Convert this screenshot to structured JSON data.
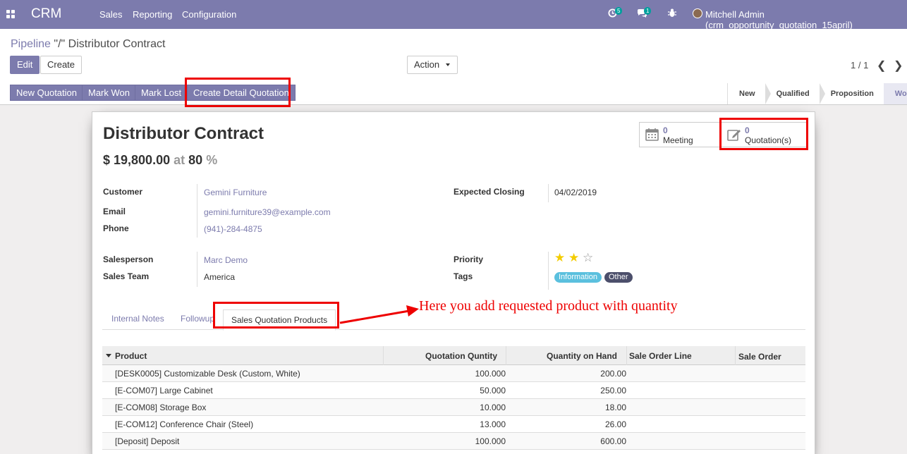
{
  "topbar": {
    "brand": "CRM",
    "menu": [
      "Sales",
      "Reporting",
      "Configuration"
    ],
    "activity_count": "5",
    "message_count": "1",
    "user": "Mitchell Admin (crm_opportunity_quotation_15april)"
  },
  "breadcrumb": {
    "parent": "Pipeline",
    "separator": " \"/\" ",
    "current": "Distributor Contract"
  },
  "buttons": {
    "edit": "Edit",
    "create": "Create",
    "action": "Action",
    "new_quotation": "New Quotation",
    "mark_won": "Mark Won",
    "mark_lost": "Mark Lost",
    "create_detail_quotation": "Create Detail Quotation"
  },
  "pager": "1 / 1",
  "stages": [
    "New",
    "Qualified",
    "Proposition",
    "Won"
  ],
  "active_stage": "Won",
  "record": {
    "title": "Distributor Contract",
    "revenue": "$ 19,800.00",
    "at": "at",
    "probability": "80",
    "percent": "%"
  },
  "stat_buttons": {
    "meeting_count": "0",
    "meeting_label": "Meeting",
    "quotation_count": "0",
    "quotation_label": "Quotation(s)"
  },
  "fields": {
    "customer_label": "Customer",
    "customer": "Gemini Furniture",
    "email_label": "Email",
    "email": "gemini.furniture39@example.com",
    "phone_label": "Phone",
    "phone": "(941)-284-4875",
    "closing_label": "Expected Closing",
    "closing": "04/02/2019",
    "salesperson_label": "Salesperson",
    "salesperson": "Marc Demo",
    "team_label": "Sales Team",
    "team": "America",
    "priority_label": "Priority",
    "priority_stars": 2,
    "priority_max": 3,
    "tags_label": "Tags",
    "tags": [
      "Information",
      "Other"
    ]
  },
  "tabs": [
    "Internal Notes",
    "Followup",
    "Sales Quotation Products"
  ],
  "annotation": "Here you add requested product with quantity",
  "table": {
    "headers": [
      "Product",
      "Quotation Quntity",
      "Quantity on Hand",
      "Sale Order Line",
      "Sale Order"
    ],
    "rows": [
      [
        "[DESK0005] Customizable Desk (Custom, White)",
        "100.000",
        "200.00"
      ],
      [
        "[E-COM07] Large Cabinet",
        "50.000",
        "250.00"
      ],
      [
        "[E-COM08] Storage Box",
        "10.000",
        "18.00"
      ],
      [
        "[E-COM12] Conference Chair (Steel)",
        "13.000",
        "26.00"
      ],
      [
        "[Deposit] Deposit",
        "100.000",
        "600.00"
      ]
    ]
  },
  "colors": {
    "brand": "#7c7bad",
    "highlight": "#ee0000",
    "tag_information": "#5bc0de",
    "tag_other": "#4c4f6b"
  }
}
